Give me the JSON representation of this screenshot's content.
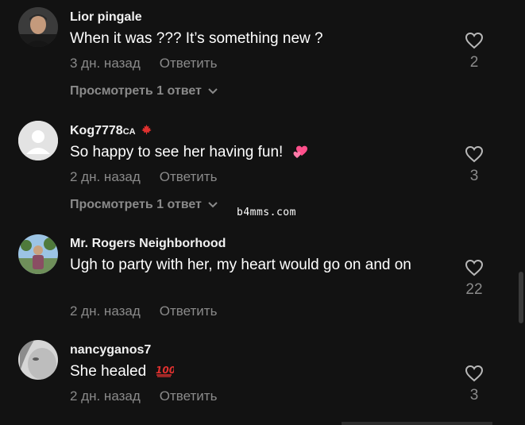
{
  "comments": [
    {
      "username": "Lior pingale",
      "text": "When it was ??? It’s something new ?",
      "time": "3 дн. назад",
      "reply_label": "Ответить",
      "likes": "2",
      "view_replies": "Просмотреть 1 ответ"
    },
    {
      "username": "Kog7778",
      "user_suffix": "CA",
      "text": "So happy to see her having fun!",
      "time": "2 дн. назад",
      "reply_label": "Ответить",
      "likes": "3",
      "view_replies": "Просмотреть 1 ответ"
    },
    {
      "username": "Mr. Rogers Neighborhood",
      "text": "Ugh to party with her, my heart would go on and on",
      "time": "2 дн. назад",
      "reply_label": "Ответить",
      "likes": "22"
    },
    {
      "username": "nancyganos7",
      "text": "She healed",
      "time": "2 дн. назад",
      "reply_label": "Ответить",
      "likes": "3"
    }
  ],
  "watermark": "b4mms.com",
  "colors": {
    "background": "#121212",
    "muted_text": "#8a8a8a",
    "primary_text": "#ffffff",
    "heart_emoji": "#ff4f8b",
    "maple_leaf": "#e0312f",
    "hundred_emoji": "#e0312f"
  }
}
